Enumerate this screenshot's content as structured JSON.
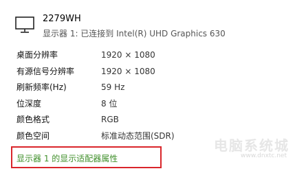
{
  "monitor": {
    "icon": "monitor-icon",
    "name": "2279WH",
    "subtitle": "显示器 1: 已连接到 Intel(R) UHD Graphics 630"
  },
  "properties": [
    {
      "label": "桌面分辨率",
      "value": "1920 × 1080"
    },
    {
      "label": "有源信号分辨率",
      "value": "1920 × 1080"
    },
    {
      "label": "刷新频率(Hz)",
      "value": "59 Hz"
    },
    {
      "label": "位深度",
      "value": "8 位"
    },
    {
      "label": "颜色格式",
      "value": "RGB"
    },
    {
      "label": "颜色空间",
      "value": "标准动态范围(SDR)"
    }
  ],
  "adapter_link": "显示器 1 的显示适配器属性",
  "watermark": {
    "text": "电脑系统城",
    "url": "www.dnxtc.net"
  },
  "colors": {
    "link": "#3f8f2a",
    "highlight_border": "#d9252a"
  }
}
